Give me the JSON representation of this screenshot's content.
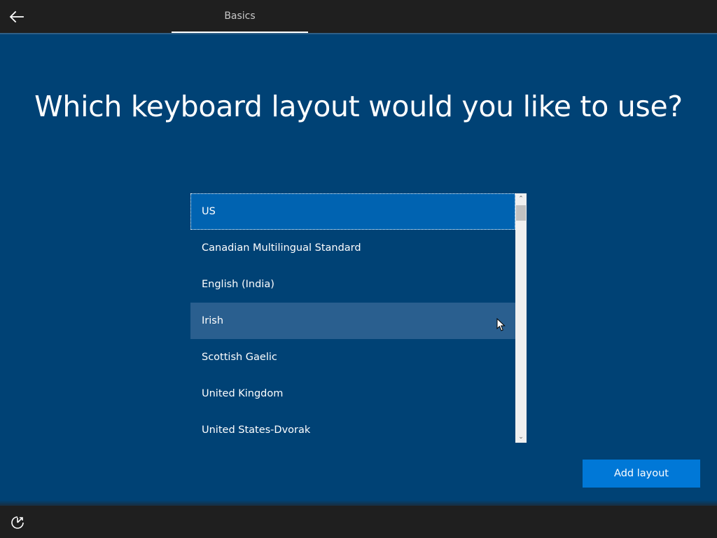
{
  "header": {
    "tab_label": "Basics",
    "back_icon": "arrow-left-icon"
  },
  "main": {
    "title": "Which keyboard layout would you like to use?"
  },
  "layout_list": {
    "items": [
      {
        "label": "US",
        "state": "selected"
      },
      {
        "label": "Canadian Multilingual Standard",
        "state": "normal"
      },
      {
        "label": "English (India)",
        "state": "normal"
      },
      {
        "label": "Irish",
        "state": "hover"
      },
      {
        "label": "Scottish Gaelic",
        "state": "normal"
      },
      {
        "label": "United Kingdom",
        "state": "normal"
      },
      {
        "label": "United States-Dvorak",
        "state": "normal"
      }
    ],
    "scroll_up_glyph": "⌃",
    "scroll_down_glyph": "⌄"
  },
  "actions": {
    "add_layout_label": "Add layout"
  },
  "footer": {
    "ease_of_access_icon": "ease-of-access-icon"
  },
  "colors": {
    "background": "#004275",
    "bar": "#1f1f1f",
    "selected": "#0063b1",
    "hover": "#2a5f8f",
    "button": "#0078d7"
  }
}
